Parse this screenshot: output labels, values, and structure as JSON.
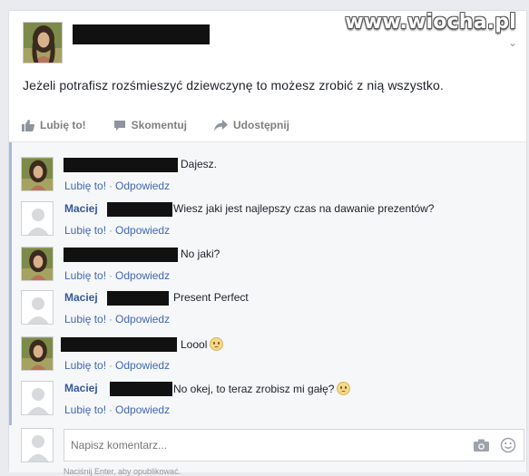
{
  "watermark": "www.wiocha.pl",
  "post": {
    "text": "Jeżeli potrafisz rozśmieszyć dziewczynę to możesz zrobić z nią wszystko."
  },
  "actions": {
    "like": "Lubię to!",
    "comment": "Skomentuj",
    "share": "Udostępnij"
  },
  "comment_meta": {
    "like": "Lubię to!",
    "sep": "·",
    "reply": "Odpowiedz"
  },
  "comments": [
    {
      "author": "",
      "text": "Dajesz."
    },
    {
      "author": "Maciej",
      "text": "Wiesz jaki jest najlepszy czas na dawanie prezentów?"
    },
    {
      "author": "",
      "text": "No jaki?"
    },
    {
      "author": "Maciej",
      "text": "Present Perfect"
    },
    {
      "author": "",
      "text": "Loool"
    },
    {
      "author": "Maciej",
      "text": "No okej, to teraz zrobisz mi gałę?"
    }
  ],
  "composer": {
    "placeholder": "Napisz komentarz...",
    "hint": "Naciśnij Enter, aby opublikować."
  },
  "colors": {
    "link": "#4267b2",
    "name": "#365899",
    "redaction": "#111111"
  },
  "icons": [
    "thumbs-up-icon",
    "comment-icon",
    "share-icon",
    "camera-icon",
    "smiley-icon",
    "chevron-down-icon"
  ]
}
